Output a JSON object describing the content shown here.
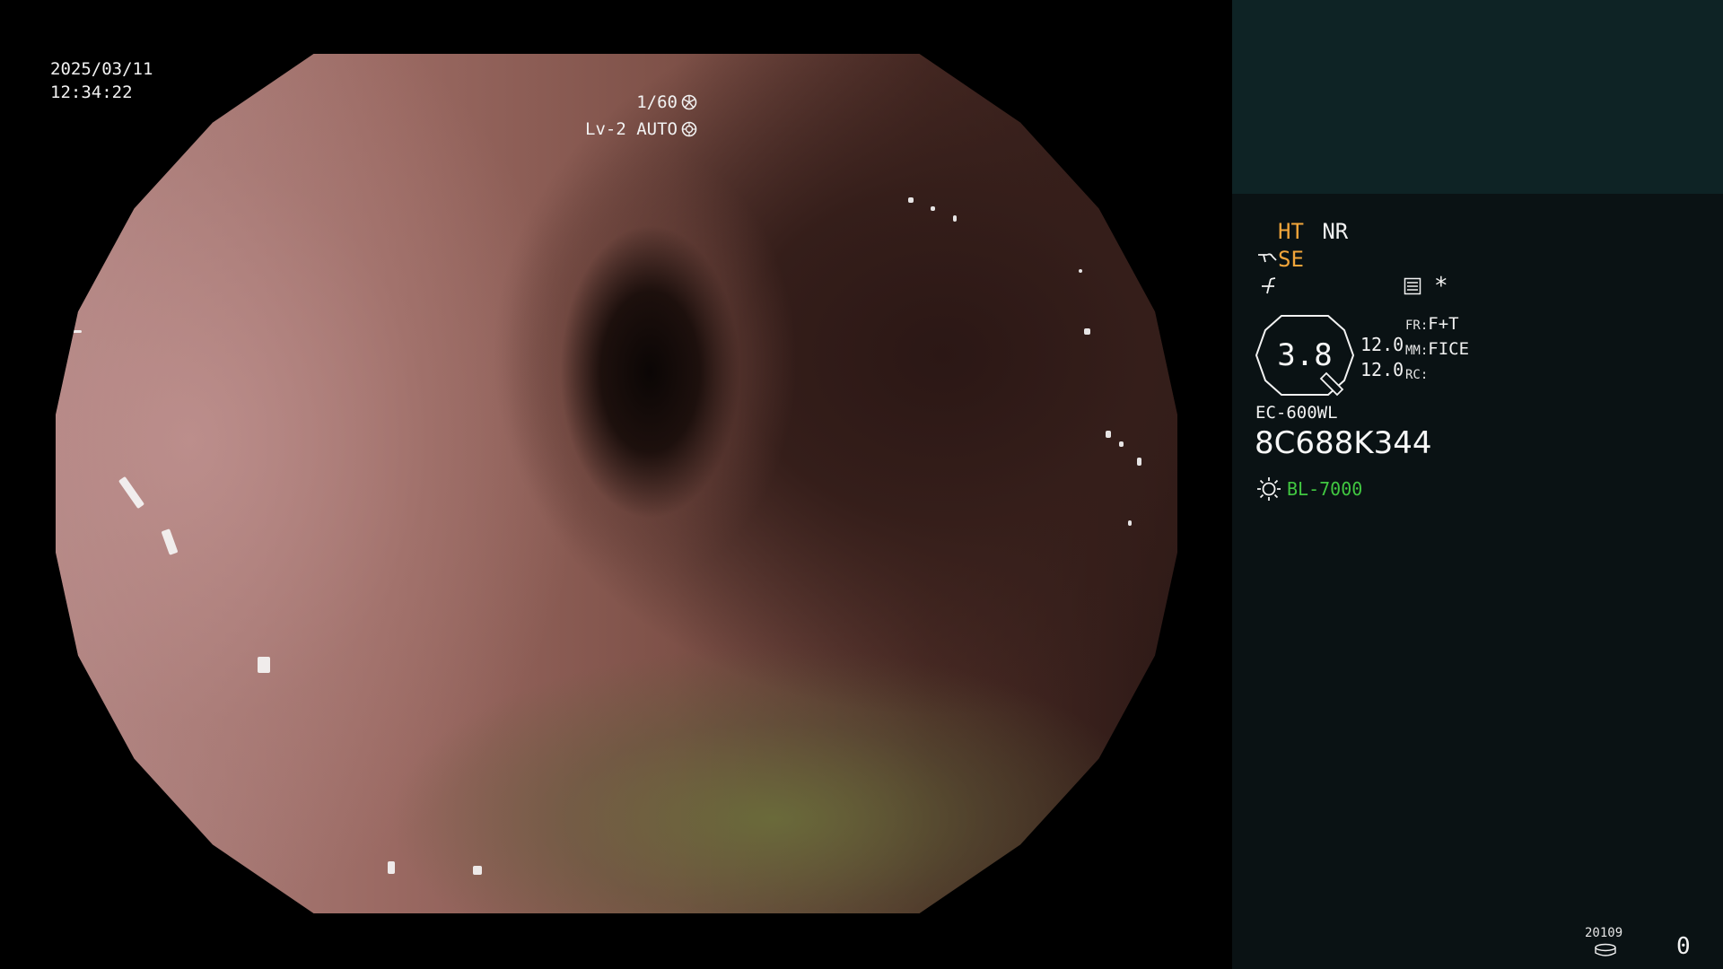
{
  "overlay": {
    "date": "2025/03/11",
    "time": "12:34:22",
    "shutter": "1/60",
    "iris_mode": "Lv-2 AUTO"
  },
  "panel": {
    "mode_ht": "HT",
    "mode_nr": "NR",
    "mode_se": "SE",
    "enhance_symbol": "*",
    "zoom_value": "3.8",
    "param_value_1": "12.0",
    "param_value_2": "12.0",
    "fr_label": "FR:",
    "fr_value": "F+T",
    "mm_label": "MM:",
    "mm_value": "FICE",
    "rc_label": "RC:",
    "scope_model": "EC-600WL",
    "scope_serial": "8C688K344",
    "light_source": "BL-7000",
    "counter_label": "20109",
    "counter_value": "0"
  },
  "colors": {
    "accent_orange": "#f2a53a",
    "light_green": "#41c741",
    "panel_bg": "#0a1214",
    "panel_header_bg": "#0e2325"
  }
}
